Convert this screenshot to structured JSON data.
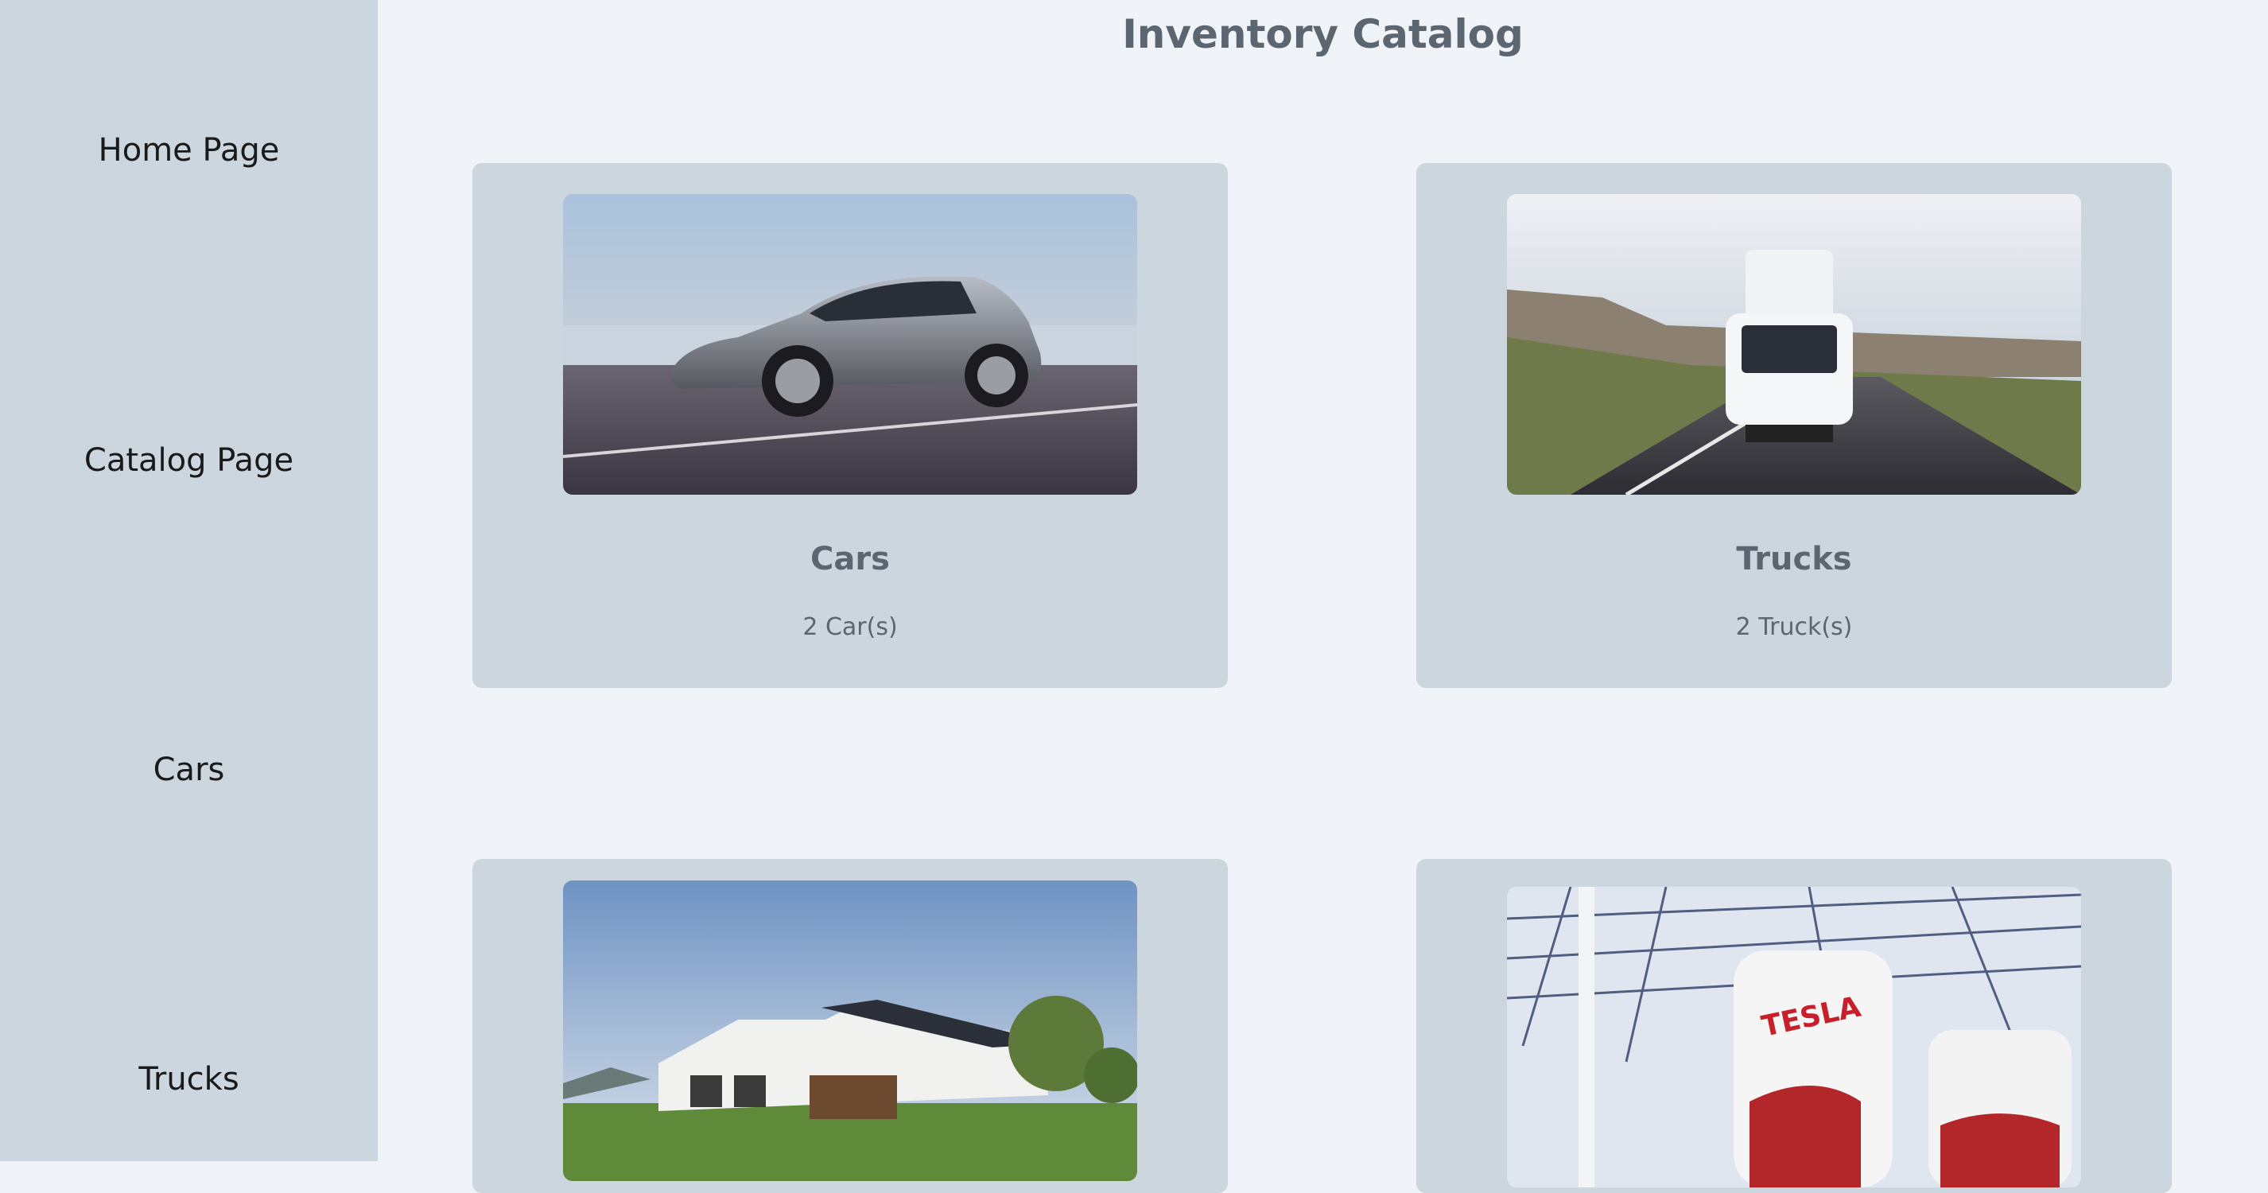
{
  "sidebar": {
    "items": [
      {
        "label": "Home Page"
      },
      {
        "label": "Catalog Page"
      },
      {
        "label": "Cars"
      },
      {
        "label": "Trucks"
      }
    ]
  },
  "main": {
    "title": "Inventory Catalog",
    "cards": [
      {
        "title": "Cars",
        "count": "2 Car(s)",
        "image": "car-photo"
      },
      {
        "title": "Trucks",
        "count": "2 Truck(s)",
        "image": "truck-photo"
      },
      {
        "title": "",
        "count": "",
        "image": "house-photo"
      },
      {
        "title": "",
        "count": "",
        "image": "charger-photo",
        "image_text": "TESLA"
      }
    ]
  }
}
